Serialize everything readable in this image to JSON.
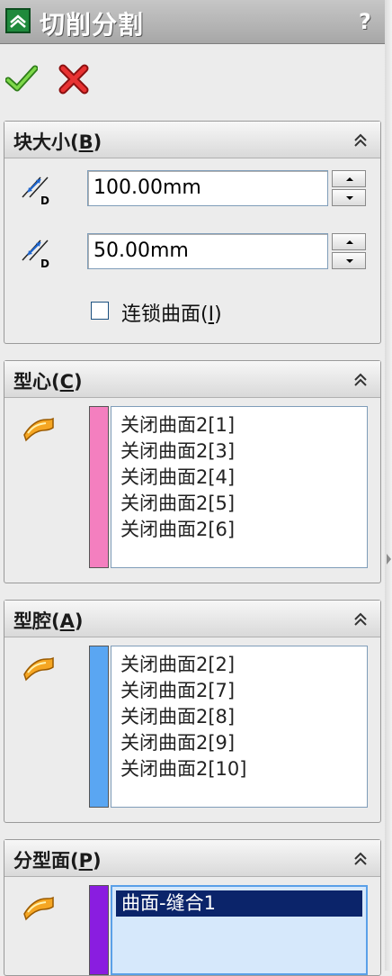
{
  "title": "切削分割",
  "help_label": "?",
  "icons": {
    "app": "mold-split-icon",
    "ok": "check-icon",
    "cancel": "x-icon",
    "collapse": "double-chevron-up-icon",
    "dimension": "dimension-d-icon",
    "pick": "flag-icon"
  },
  "colors": {
    "core": "#f47fbf",
    "cavity": "#5aa6f2",
    "parting": "#8a1de0",
    "selection": "#0b246a"
  },
  "block_size": {
    "title_prefix": "块大小(",
    "title_key": "B",
    "title_suffix": ")",
    "depth1": "100.00mm",
    "depth2": "50.00mm",
    "interlock_label_prefix": "连锁曲面(",
    "interlock_key": "I",
    "interlock_label_suffix": ")",
    "interlock_checked": false
  },
  "core": {
    "title_prefix": "型心(",
    "title_key": "C",
    "title_suffix": ")",
    "items": [
      "关闭曲面2[1]",
      "关闭曲面2[3]",
      "关闭曲面2[4]",
      "关闭曲面2[5]",
      "关闭曲面2[6]"
    ]
  },
  "cavity": {
    "title_prefix": "型腔(",
    "title_key": "A",
    "title_suffix": ")",
    "items": [
      "关闭曲面2[2]",
      "关闭曲面2[7]",
      "关闭曲面2[8]",
      "关闭曲面2[9]",
      "关闭曲面2[10]"
    ]
  },
  "parting": {
    "title_prefix": "分型面(",
    "title_key": "P",
    "title_suffix": ")",
    "items": [
      "曲面-缝合1"
    ]
  }
}
